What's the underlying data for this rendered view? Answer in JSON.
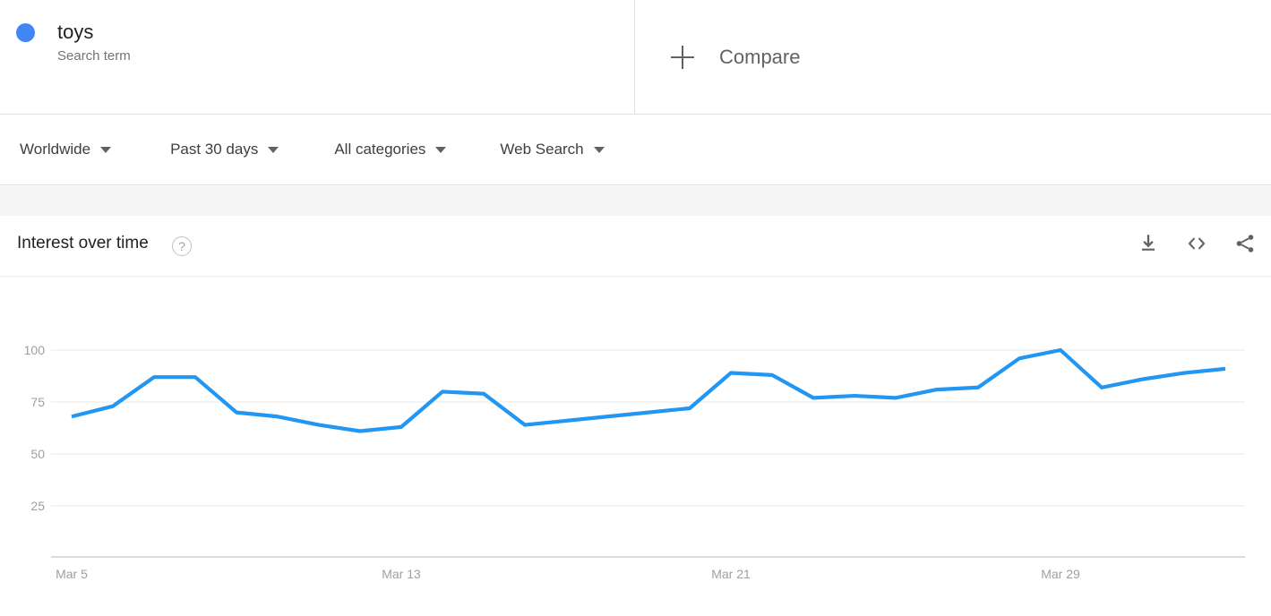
{
  "terms": [
    {
      "label": "toys",
      "sublabel": "Search term",
      "color": "#4285F4"
    }
  ],
  "compare": {
    "label": "Compare",
    "icon": "plus-icon"
  },
  "filters": [
    {
      "name": "location",
      "value": "Worldwide"
    },
    {
      "name": "time-range",
      "value": "Past 30 days"
    },
    {
      "name": "category",
      "value": "All categories"
    },
    {
      "name": "search-type",
      "value": "Web Search"
    }
  ],
  "card": {
    "title": "Interest over time",
    "help_icon": "?",
    "actions": [
      {
        "name": "download-icon",
        "label": "Download"
      },
      {
        "name": "embed-icon",
        "label": "Embed"
      },
      {
        "name": "share-icon",
        "label": "Share"
      }
    ]
  },
  "chart_data": {
    "type": "line",
    "title": "Interest over time",
    "xlabel": "",
    "ylabel": "",
    "ylim": [
      0,
      108
    ],
    "yticks": [
      25,
      50,
      75,
      100
    ],
    "grid": true,
    "legend": "none",
    "line_color": "#2196F3",
    "x_tick_labels": [
      "Mar 5",
      "Mar 13",
      "Mar 21",
      "Mar 29"
    ],
    "x_tick_indices": [
      0,
      8,
      16,
      24
    ],
    "x": [
      "Mar 5",
      "Mar 6",
      "Mar 7",
      "Mar 8",
      "Mar 9",
      "Mar 10",
      "Mar 11",
      "Mar 12",
      "Mar 13",
      "Mar 14",
      "Mar 15",
      "Mar 16",
      "Mar 17",
      "Mar 18",
      "Mar 19",
      "Mar 20",
      "Mar 21",
      "Mar 22",
      "Mar 23",
      "Mar 24",
      "Mar 25",
      "Mar 26",
      "Mar 27",
      "Mar 28",
      "Mar 29",
      "Mar 30",
      "Mar 31",
      "Apr 1",
      "Apr 2"
    ],
    "series": [
      {
        "name": "toys",
        "values": [
          68,
          73,
          87,
          87,
          70,
          68,
          64,
          61,
          63,
          80,
          79,
          64,
          66,
          68,
          70,
          72,
          89,
          88,
          77,
          78,
          77,
          81,
          82,
          96,
          100,
          82,
          86,
          89,
          91
        ]
      }
    ]
  }
}
